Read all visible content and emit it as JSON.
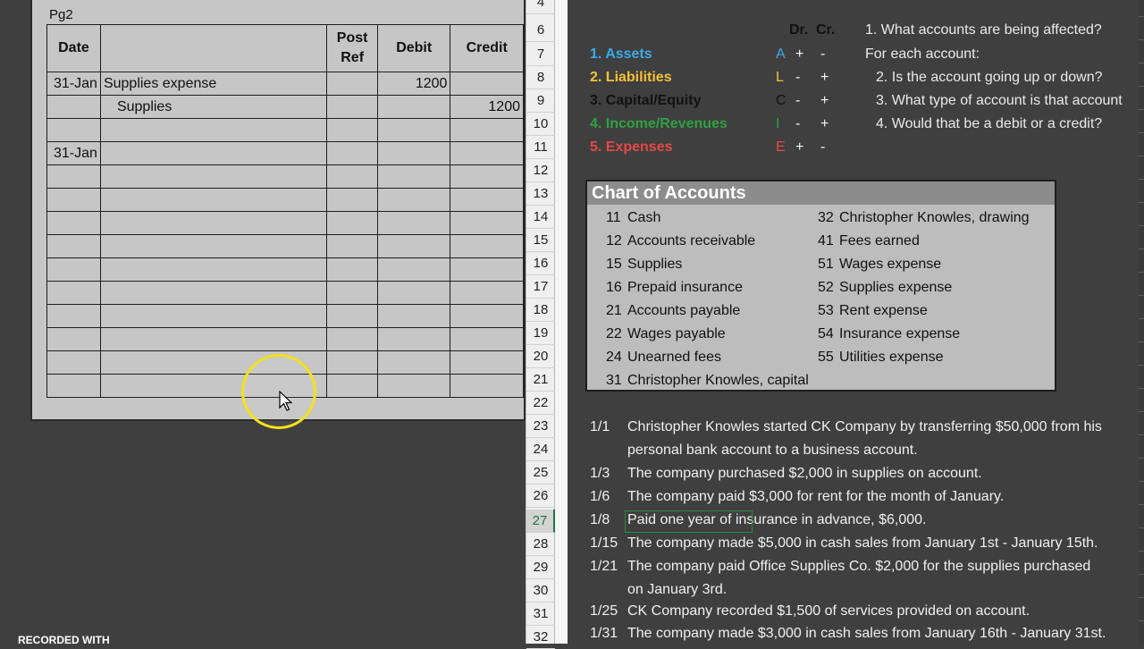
{
  "journal": {
    "page_label": "Pg2",
    "headers": {
      "date": "Date",
      "desc": "",
      "post_ref": "Post Ref",
      "debit": "Debit",
      "credit": "Credit"
    },
    "rows": [
      {
        "date": "31-Jan",
        "desc": "Supplies expense",
        "indent": false,
        "post_ref": "",
        "debit": "1200",
        "credit": ""
      },
      {
        "date": "",
        "desc": "Supplies",
        "indent": true,
        "post_ref": "",
        "debit": "",
        "credit": "1200"
      },
      {
        "date": "",
        "desc": "",
        "indent": false,
        "post_ref": "",
        "debit": "",
        "credit": ""
      },
      {
        "date": "31-Jan",
        "desc": "",
        "indent": false,
        "post_ref": "",
        "debit": "",
        "credit": ""
      },
      {
        "date": "",
        "desc": "",
        "indent": false,
        "post_ref": "",
        "debit": "",
        "credit": ""
      },
      {
        "date": "",
        "desc": "",
        "indent": false,
        "post_ref": "",
        "debit": "",
        "credit": ""
      },
      {
        "date": "",
        "desc": "",
        "indent": false,
        "post_ref": "",
        "debit": "",
        "credit": ""
      },
      {
        "date": "",
        "desc": "",
        "indent": false,
        "post_ref": "",
        "debit": "",
        "credit": ""
      },
      {
        "date": "",
        "desc": "",
        "indent": false,
        "post_ref": "",
        "debit": "",
        "credit": ""
      },
      {
        "date": "",
        "desc": "",
        "indent": false,
        "post_ref": "",
        "debit": "",
        "credit": ""
      },
      {
        "date": "",
        "desc": "",
        "indent": false,
        "post_ref": "",
        "debit": "",
        "credit": ""
      },
      {
        "date": "",
        "desc": "",
        "indent": false,
        "post_ref": "",
        "debit": "",
        "credit": ""
      },
      {
        "date": "",
        "desc": "",
        "indent": false,
        "post_ref": "",
        "debit": "",
        "credit": ""
      },
      {
        "date": "",
        "desc": "",
        "indent": false,
        "post_ref": "",
        "debit": "",
        "credit": ""
      }
    ]
  },
  "row_numbers": [
    "4",
    "6",
    "7",
    "8",
    "9",
    "10",
    "11",
    "12",
    "13",
    "14",
    "15",
    "16",
    "17",
    "18",
    "19",
    "20",
    "21",
    "22",
    "23",
    "24",
    "25",
    "26",
    "27",
    "28",
    "29",
    "30",
    "31",
    "32"
  ],
  "selected_row": "27",
  "account_types": {
    "header_dr": "Dr.",
    "header_cr": "Cr.",
    "items": [
      {
        "label": "1. Assets",
        "letter": "A",
        "dr": "+",
        "cr": "-",
        "color": "#3da9e8"
      },
      {
        "label": "2. Liabilities",
        "letter": "L",
        "dr": "-",
        "cr": "+",
        "color": "#f4c233"
      },
      {
        "label": "3. Capital/Equity",
        "letter": "C",
        "dr": "-",
        "cr": "+",
        "color": "#111111"
      },
      {
        "label": "4. Income/Revenues",
        "letter": "I",
        "dr": "-",
        "cr": "+",
        "color": "#2ea043"
      },
      {
        "label": "5. Expenses",
        "letter": "E",
        "dr": "+",
        "cr": "-",
        "color": "#e84848"
      }
    ]
  },
  "questions": [
    "1. What accounts are being affected?",
    "For each account:",
    "2. Is the account going up or down?",
    "3. What type of account is that account",
    "4. Would that be a debit or a credit?"
  ],
  "chart_of_accounts": {
    "title": "Chart of Accounts",
    "left": [
      {
        "num": "11",
        "name": "Cash"
      },
      {
        "num": "12",
        "name": "Accounts receivable"
      },
      {
        "num": "15",
        "name": "Supplies"
      },
      {
        "num": "16",
        "name": "Prepaid insurance"
      },
      {
        "num": "21",
        "name": "Accounts payable"
      },
      {
        "num": "22",
        "name": "Wages payable"
      },
      {
        "num": "24",
        "name": "Unearned fees"
      },
      {
        "num": "31",
        "name": "Christopher Knowles, capital"
      }
    ],
    "right": [
      {
        "num": "32",
        "name": "Christopher Knowles, drawing"
      },
      {
        "num": "41",
        "name": "Fees earned"
      },
      {
        "num": "51",
        "name": "Wages expense"
      },
      {
        "num": "52",
        "name": "Supplies expense"
      },
      {
        "num": "53",
        "name": "Rent expense"
      },
      {
        "num": "54",
        "name": "Insurance expense"
      },
      {
        "num": "55",
        "name": "Utilities expense"
      }
    ]
  },
  "transactions": [
    {
      "date": "1/1",
      "text": "Christopher Knowles started CK Company by transferring $50,000 from his"
    },
    {
      "date": "",
      "text": " personal bank account to a business account."
    },
    {
      "date": "1/3",
      "text": "The company purchased $2,000 in supplies on account."
    },
    {
      "date": "1/6",
      "text": "The company paid $3,000 for rent for the month of January."
    },
    {
      "date": "1/8",
      "text": "Paid one year of insurance in advance, $6,000."
    },
    {
      "date": "1/15",
      "text": "The company made $5,000 in cash sales from January 1st - January 15th."
    },
    {
      "date": "1/21",
      "text": "The company paid Office Supplies Co. $2,000 for the supplies purchased"
    },
    {
      "date": "",
      "text": "on January 3rd."
    },
    {
      "date": "1/25",
      "text": "CK Company recorded $1,500 of services provided on account."
    },
    {
      "date": "1/31",
      "text": "The company made $3,000 in cash sales from January 16th - January 31st."
    }
  ],
  "recorded_with": "RECORDED WITH"
}
